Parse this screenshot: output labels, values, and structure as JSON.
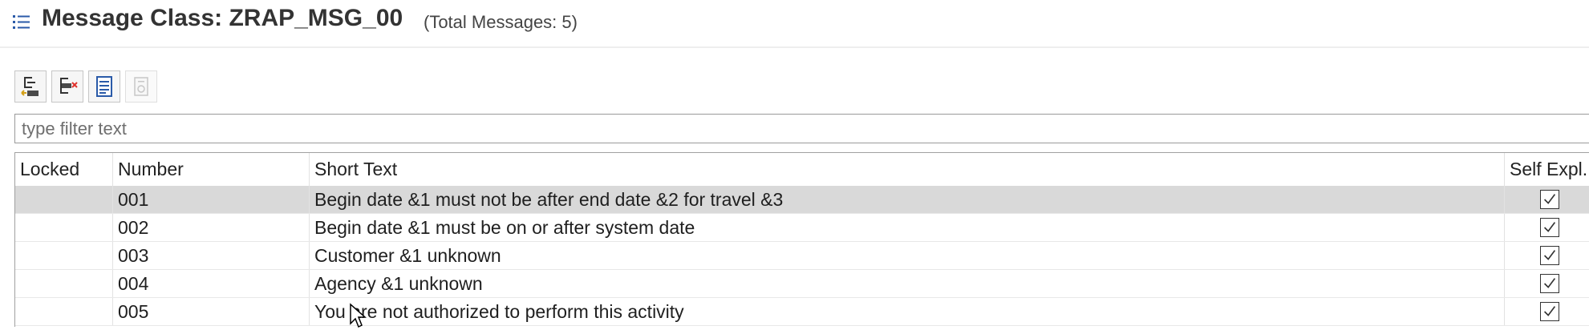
{
  "header": {
    "title": "Message Class: ZRAP_MSG_00",
    "total": "(Total Messages: 5)",
    "icon": "list-icon"
  },
  "toolbar": {
    "buttons": [
      {
        "icon": "add-message-icon",
        "enabled": true
      },
      {
        "icon": "delete-message-icon",
        "enabled": true
      },
      {
        "icon": "long-text-icon",
        "enabled": true
      },
      {
        "icon": "where-used-icon",
        "enabled": false
      }
    ]
  },
  "filter": {
    "placeholder": "type filter text",
    "value": ""
  },
  "table": {
    "columns": [
      "Locked",
      "Number",
      "Short Text",
      "Self Expl..."
    ],
    "rows": [
      {
        "locked": "",
        "number": "001",
        "short_text": "Begin date &1 must not be after end date &2 for travel &3",
        "self_explanatory": true,
        "selected": true
      },
      {
        "locked": "",
        "number": "002",
        "short_text": "Begin date &1 must be on or after system date",
        "self_explanatory": true,
        "selected": false
      },
      {
        "locked": "",
        "number": "003",
        "short_text": "Customer &1 unknown",
        "self_explanatory": true,
        "selected": false
      },
      {
        "locked": "",
        "number": "004",
        "short_text": "Agency &1 unknown",
        "self_explanatory": true,
        "selected": false
      },
      {
        "locked": "",
        "number": "005",
        "short_text": "You are not authorized to perform this activity",
        "self_explanatory": true,
        "selected": false
      }
    ]
  }
}
